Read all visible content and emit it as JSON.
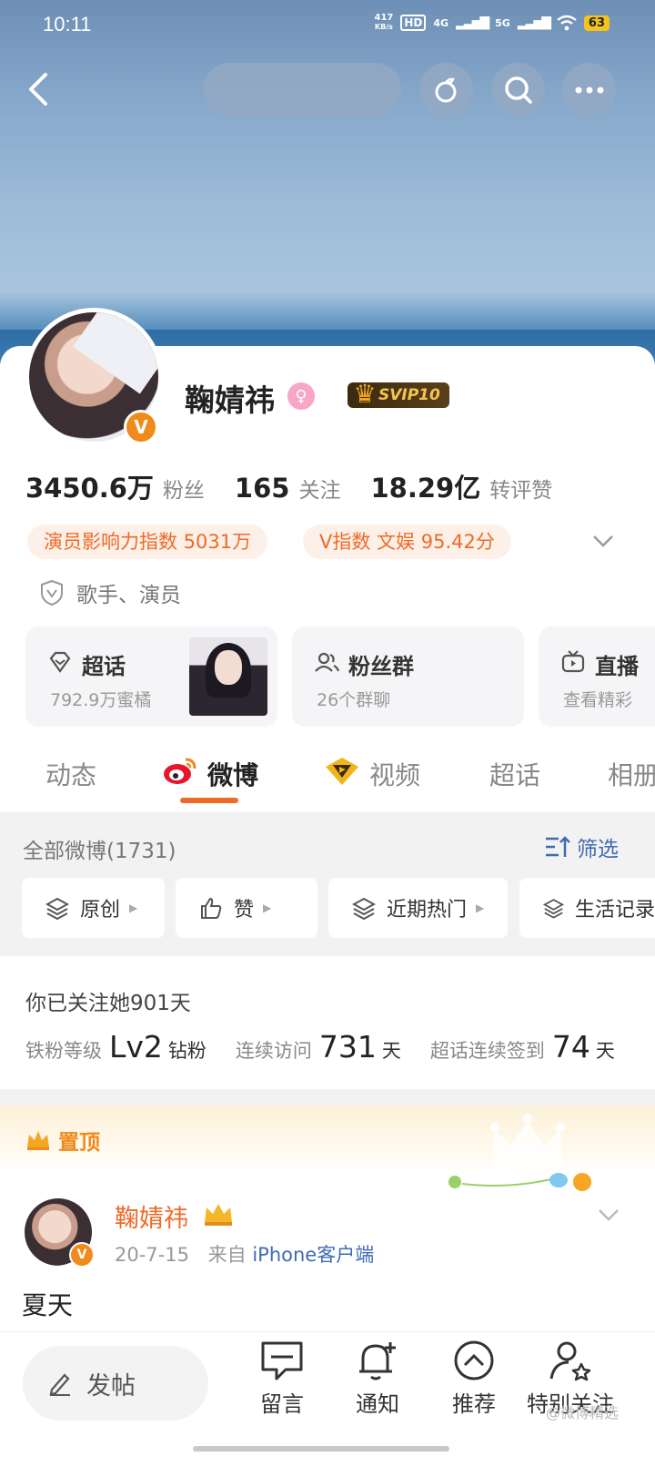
{
  "status_bar": {
    "time": "10:11",
    "net_speed": "417",
    "net_unit": "KB/s",
    "hd": "HD",
    "sig1": "4G",
    "sig2": "5G",
    "battery": "63"
  },
  "profile": {
    "name": "鞠婧祎",
    "svip": "SVIP10",
    "stats": [
      {
        "value": "3450.6万",
        "label": "粉丝"
      },
      {
        "value": "165",
        "label": "关注"
      },
      {
        "value": "18.29亿",
        "label": "转评赞"
      }
    ],
    "pills": [
      "演员影响力指数 5031万",
      "V指数 文娱 95.42分"
    ],
    "verification": "歌手、演员"
  },
  "features": [
    {
      "title": "超话",
      "sub": "792.9万蜜橘"
    },
    {
      "title": "粉丝群",
      "sub": "26个群聊"
    },
    {
      "title": "直播",
      "sub": "查看精彩"
    }
  ],
  "tabs": [
    "动态",
    "微博",
    "视频",
    "超话",
    "相册"
  ],
  "active_tab": "微博",
  "filter": {
    "all_count": "全部微博(1731)",
    "filter_label": "筛选",
    "chips": [
      "原创",
      "赞",
      "近期热门",
      "生活记录"
    ]
  },
  "fan_info": {
    "follow_days": "你已关注她901天",
    "items": [
      {
        "label": "铁粉等级",
        "value": "Lv2",
        "unit": "钻粉"
      },
      {
        "label": "连续访问",
        "value": "731",
        "unit": "天"
      },
      {
        "label": "超话连续签到",
        "value": "74",
        "unit": "天"
      }
    ]
  },
  "pinned": {
    "label": "置顶",
    "author": "鞠婧祎",
    "date": "20-7-15",
    "from_prefix": "来自",
    "source": "iPhone客户端",
    "text": "夏天"
  },
  "bottom_nav": {
    "compose": "发帖",
    "items": [
      "留言",
      "通知",
      "推荐",
      "特别关注"
    ]
  },
  "watermark": "@微博精选"
}
